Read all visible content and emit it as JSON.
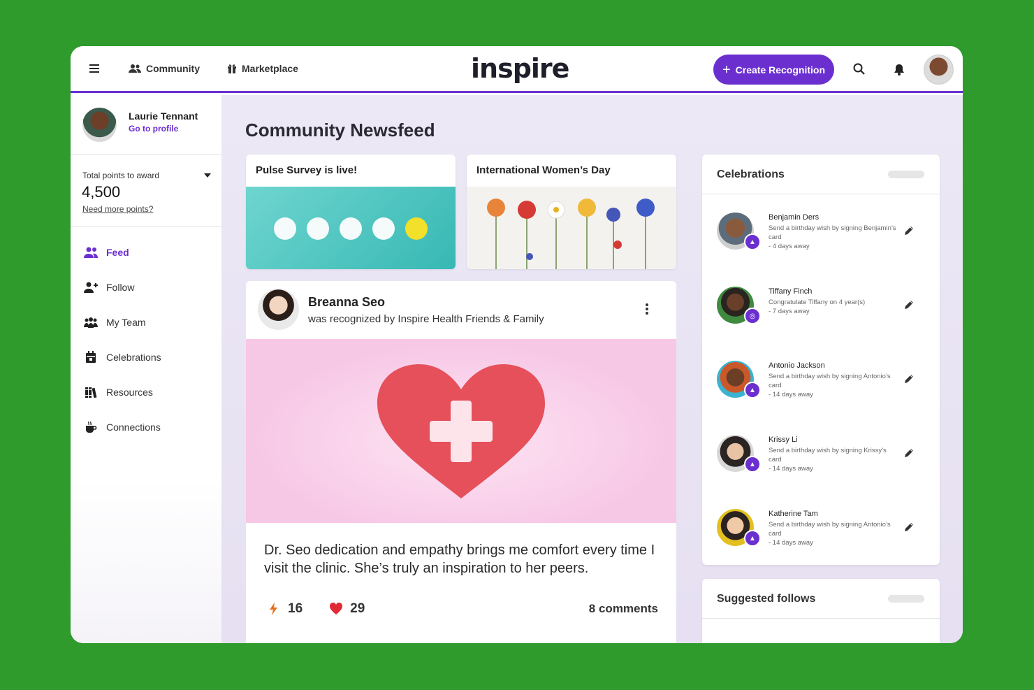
{
  "topbar": {
    "nav": [
      {
        "label": "Community",
        "icon": "people-icon"
      },
      {
        "label": "Marketplace",
        "icon": "gift-icon"
      }
    ],
    "logo": "inspire",
    "create_label": "Create Recognition",
    "accent": "#6b2fd0"
  },
  "sidebar": {
    "profile": {
      "name": "Laurie Tennant",
      "link": "Go to profile"
    },
    "points": {
      "label": "Total points to award",
      "value": "4,500",
      "more": "Need more points?"
    },
    "items": [
      {
        "label": "Feed",
        "icon": "people-icon",
        "active": true
      },
      {
        "label": "Follow",
        "icon": "add-person-icon"
      },
      {
        "label": "My Team",
        "icon": "team-icon"
      },
      {
        "label": "Celebrations",
        "icon": "calendar-icon"
      },
      {
        "label": "Resources",
        "icon": "books-icon"
      },
      {
        "label": "Connections",
        "icon": "coffee-icon"
      }
    ]
  },
  "main": {
    "title": "Community Newsfeed",
    "promos": [
      {
        "title": "Pulse Survey is live!"
      },
      {
        "title": "International Women’s Day"
      }
    ],
    "post": {
      "name": "Breanna Seo",
      "subtitle": "was recognized by Inspire Health Friends & Family",
      "text": "Dr. Seo dedication and empathy brings me comfort every time I visit the clinic. She’s truly an inspiration to her peers.",
      "boosts": "16",
      "likes": "29",
      "comments": "8 comments"
    }
  },
  "celebrations": {
    "title": "Celebrations",
    "items": [
      {
        "name": "Benjamin Ders",
        "desc": "Send a birthday wish by signing Benjamin’s card",
        "when": "- 4 days away",
        "badge": "birthday"
      },
      {
        "name": "Tiffany Finch",
        "desc": "Congratulate Tiffany on 4 year(s)",
        "when": "- 7 days away",
        "badge": "anniversary"
      },
      {
        "name": "Antonio Jackson",
        "desc": "Send a birthday wish by signing Antonio’s card",
        "when": "- 14 days away",
        "badge": "birthday"
      },
      {
        "name": "Krissy Li",
        "desc": "Send a birthday wish by signing Krissy’s card",
        "when": "- 14 days away",
        "badge": "birthday"
      },
      {
        "name": "Katherine Tam",
        "desc": "Send a birthday wish by signing Antonio’s card",
        "when": "- 14 days away",
        "badge": "birthday"
      }
    ]
  },
  "suggested": {
    "title": "Suggested follows"
  }
}
